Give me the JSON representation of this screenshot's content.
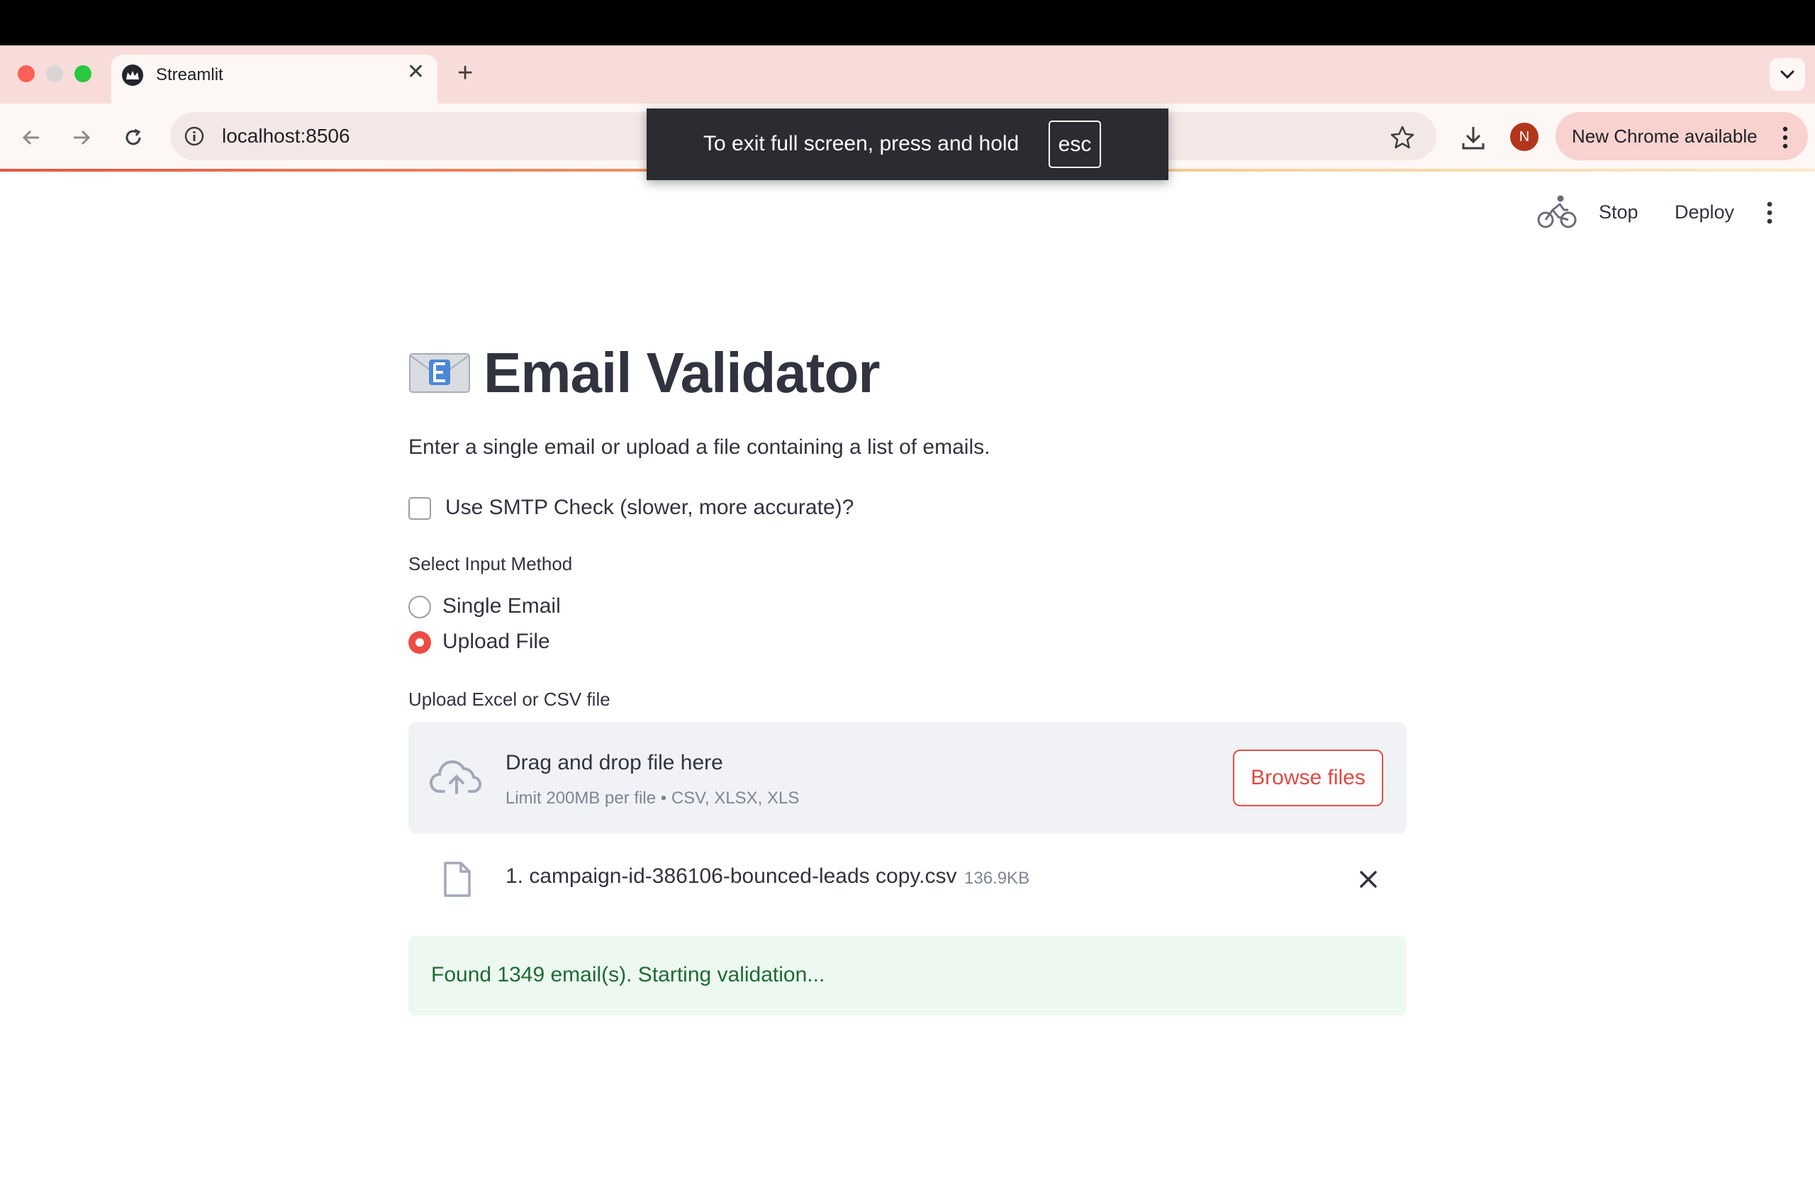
{
  "browser": {
    "tab_title": "Streamlit",
    "new_tab_symbol": "+",
    "close_symbol": "✕",
    "url": "localhost:8506",
    "profile_initial": "N",
    "update_label": "New Chrome available",
    "fullscreen_message": "To exit full screen, press and hold",
    "fullscreen_key": "esc"
  },
  "streamlit_header": {
    "stop_label": "Stop",
    "deploy_label": "Deploy"
  },
  "app": {
    "title": "Email Validator",
    "description": "Enter a single email or upload a file containing a list of emails.",
    "smtp_checkbox_label": "Use SMTP Check (slower, more accurate)?",
    "smtp_checked": false,
    "input_method": {
      "label": "Select Input Method",
      "options": [
        "Single Email",
        "Upload File"
      ],
      "selected": "Upload File"
    },
    "uploader": {
      "label": "Upload Excel or CSV file",
      "drop_title": "Drag and drop file here",
      "drop_subtitle": "Limit 200MB per file • CSV, XLSX, XLS",
      "browse_label": "Browse files",
      "file_name": "1. campaign-id-386106-bounced-leads copy.csv",
      "file_size": "136.9KB"
    },
    "status_message": "Found 1349 email(s). Starting validation..."
  },
  "icons": {
    "tab_favicon": "streamlit-crown-icon",
    "title_emoji": "envelope-e-icon",
    "upload": "cloud-upload-icon",
    "file": "file-icon",
    "remove": "close-icon",
    "running": "cyclist-icon"
  },
  "colors": {
    "accent": "#ee4b45",
    "success_bg": "#edf8f0",
    "success_text": "#1f6b35",
    "text": "#31333f",
    "muted": "#808495"
  }
}
